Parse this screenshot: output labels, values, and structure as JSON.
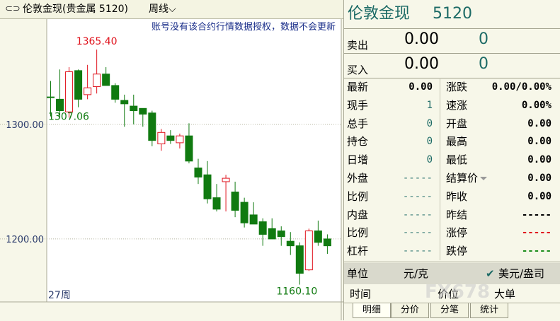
{
  "title": {
    "link_icon": "link-icon",
    "name": "伦敦金现(贵金属 5120)",
    "period": "周线",
    "chevron": "⌵"
  },
  "chart_data": {
    "type": "candlestick",
    "period_label": "27周",
    "notice": "账号没有该合约行情数据授权，数据不会更新",
    "y_ticks": [
      "1300.00",
      "1200.00"
    ],
    "y_tick_values": [
      1300,
      1200
    ],
    "ylim": [
      1145,
      1392
    ],
    "max_label": "1365.40",
    "max_value": 1365.4,
    "min_label": "1160.10",
    "min_value": 1160.1,
    "ref_label": "1307.06",
    "ref_value": 1307.06,
    "grid": "dotted-horizontal",
    "colors": {
      "up": "#e0141e",
      "down": "#107a10",
      "grid": "#b8b8a4",
      "axis_text": "#2f3f6e"
    },
    "candles": [
      {
        "o": 1324,
        "h": 1338,
        "l": 1307,
        "c": 1324
      },
      {
        "o": 1322,
        "h": 1348,
        "l": 1306,
        "c": 1312
      },
      {
        "o": 1311,
        "h": 1350,
        "l": 1306,
        "c": 1346
      },
      {
        "o": 1347,
        "h": 1348,
        "l": 1315,
        "c": 1322
      },
      {
        "o": 1326,
        "h": 1352,
        "l": 1322,
        "c": 1332
      },
      {
        "o": 1333,
        "h": 1365.4,
        "l": 1327,
        "c": 1344
      },
      {
        "o": 1344,
        "h": 1350,
        "l": 1334,
        "c": 1334
      },
      {
        "o": 1334,
        "h": 1336,
        "l": 1319,
        "c": 1322
      },
      {
        "o": 1321,
        "h": 1326,
        "l": 1298,
        "c": 1318
      },
      {
        "o": 1316,
        "h": 1326,
        "l": 1300,
        "c": 1312
      },
      {
        "o": 1314,
        "h": 1314,
        "l": 1298,
        "c": 1309
      },
      {
        "o": 1310,
        "h": 1312,
        "l": 1281,
        "c": 1286
      },
      {
        "o": 1283,
        "h": 1296,
        "l": 1277,
        "c": 1293
      },
      {
        "o": 1290,
        "h": 1295,
        "l": 1283,
        "c": 1286
      },
      {
        "o": 1284,
        "h": 1292,
        "l": 1279,
        "c": 1290
      },
      {
        "o": 1290,
        "h": 1301,
        "l": 1266,
        "c": 1268
      },
      {
        "o": 1262,
        "h": 1270,
        "l": 1248,
        "c": 1254
      },
      {
        "o": 1256,
        "h": 1268,
        "l": 1231,
        "c": 1235
      },
      {
        "o": 1236,
        "h": 1248,
        "l": 1224,
        "c": 1226
      },
      {
        "o": 1250,
        "h": 1256,
        "l": 1224,
        "c": 1253
      },
      {
        "o": 1241,
        "h": 1250,
        "l": 1219,
        "c": 1225
      },
      {
        "o": 1232,
        "h": 1236,
        "l": 1210,
        "c": 1214
      },
      {
        "o": 1221,
        "h": 1232,
        "l": 1213,
        "c": 1213
      },
      {
        "o": 1215,
        "h": 1218,
        "l": 1194,
        "c": 1204
      },
      {
        "o": 1209,
        "h": 1218,
        "l": 1200,
        "c": 1200
      },
      {
        "o": 1207,
        "h": 1211,
        "l": 1194,
        "c": 1202
      },
      {
        "o": 1198,
        "h": 1206,
        "l": 1186,
        "c": 1194
      },
      {
        "o": 1194,
        "h": 1197,
        "l": 1160.1,
        "c": 1170
      },
      {
        "o": 1173,
        "h": 1209,
        "l": 1172,
        "c": 1207
      },
      {
        "o": 1207,
        "h": 1216,
        "l": 1194,
        "c": 1197
      },
      {
        "o": 1200,
        "h": 1204,
        "l": 1187,
        "c": 1194
      }
    ]
  },
  "panel": {
    "name": "伦敦金现",
    "code": "5120",
    "sell": {
      "label": "卖出",
      "price": "0.00",
      "vol": "0"
    },
    "buy": {
      "label": "买入",
      "price": "0.00",
      "vol": "0"
    },
    "left": [
      {
        "label": "最新",
        "value": "0.00",
        "style": "bold"
      },
      {
        "label": "现手",
        "value": "1",
        "style": "teal"
      },
      {
        "label": "总手",
        "value": "0",
        "style": "teal"
      },
      {
        "label": "持仓",
        "value": "0",
        "style": "teal"
      },
      {
        "label": "日增",
        "value": "0",
        "style": "teal"
      },
      {
        "label": "外盘",
        "value": "-----",
        "style": "dash-teal"
      },
      {
        "label": "比例",
        "value": "-----",
        "style": "dash-teal"
      },
      {
        "label": "内盘",
        "value": "-----",
        "style": "dash-teal"
      },
      {
        "label": "比例",
        "value": "-----",
        "style": "dash-teal"
      },
      {
        "label": "杠杆",
        "value": "-----",
        "style": "dash-teal"
      }
    ],
    "right": [
      {
        "label": "涨跌",
        "value": "0.00/0.00%",
        "style": "dash-black"
      },
      {
        "label": "速涨",
        "value": "0.00%",
        "style": "dash-black"
      },
      {
        "label": "开盘",
        "value": "0.00",
        "style": "dash-black"
      },
      {
        "label": "最高",
        "value": "0.00",
        "style": "dash-black"
      },
      {
        "label": "最低",
        "value": "0.00",
        "style": "dash-black"
      },
      {
        "label": "结算价",
        "value": "0.00",
        "style": "dash-black",
        "dropdown": true
      },
      {
        "label": "昨收",
        "value": "0.00",
        "style": "dash-black"
      },
      {
        "label": "昨结",
        "value": "-----",
        "style": "dash-black"
      },
      {
        "label": "涨停",
        "value": "-----",
        "style": "dash-red"
      },
      {
        "label": "跌停",
        "value": "-----",
        "style": "dash-green"
      }
    ],
    "unit_label": "单位",
    "unit_value": "元/克",
    "unit_check": "✔",
    "unit_alt": "美元/盎司",
    "trade_header": {
      "time": "时间",
      "price": "价位",
      "size": "大单"
    },
    "tabs": [
      "明细",
      "分价",
      "分笔",
      "统计"
    ],
    "watermark": "FX678"
  }
}
